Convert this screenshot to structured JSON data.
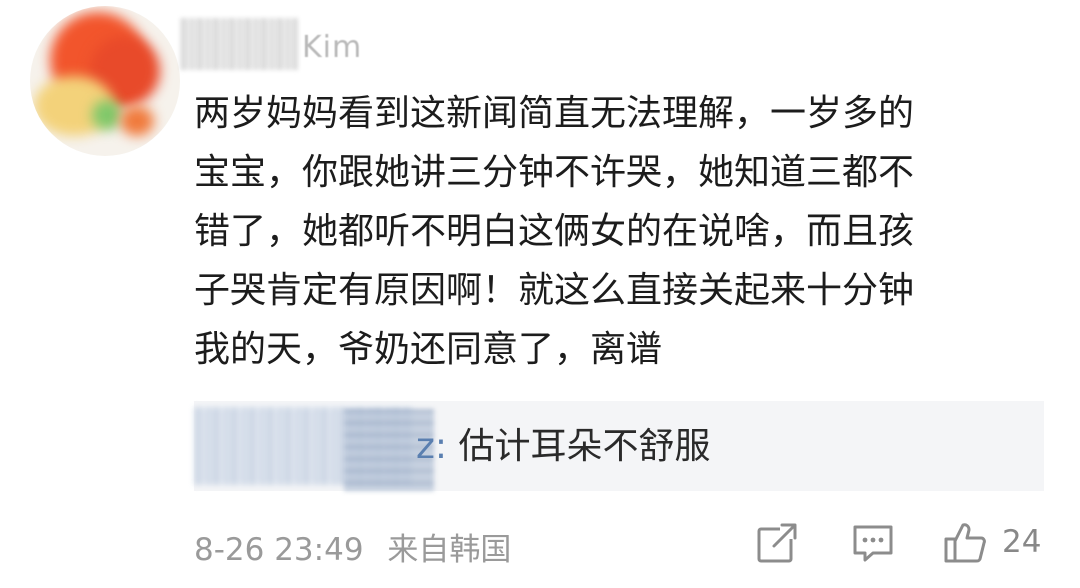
{
  "comment": {
    "author_visible_suffix": "Kim",
    "body_lines": [
      "两岁妈妈看到这新闻简直无法理解，一岁多的",
      "宝宝，你跟她讲三分钟不许哭，她知道三都不",
      "错了，她都听不明白这俩女的在说啥，而且孩",
      "子哭肯定有原因啊！就这么直接关起来十分钟",
      "我的天，爷奶还同意了，离谱"
    ],
    "reply": {
      "user_visible_suffix": "z:",
      "content": "估计耳朵不舒服"
    },
    "timestamp": "8-26 23:49",
    "source": "来自韩国",
    "like_count": "24"
  },
  "icons": {
    "repost": "repost-icon",
    "comment": "comment-icon",
    "like": "like-icon"
  },
  "colors": {
    "text": "#1c1c1c",
    "reply_user": "#5a7fb0",
    "meta": "#9a9a9a",
    "reply_bg": "#f4f5f7"
  }
}
